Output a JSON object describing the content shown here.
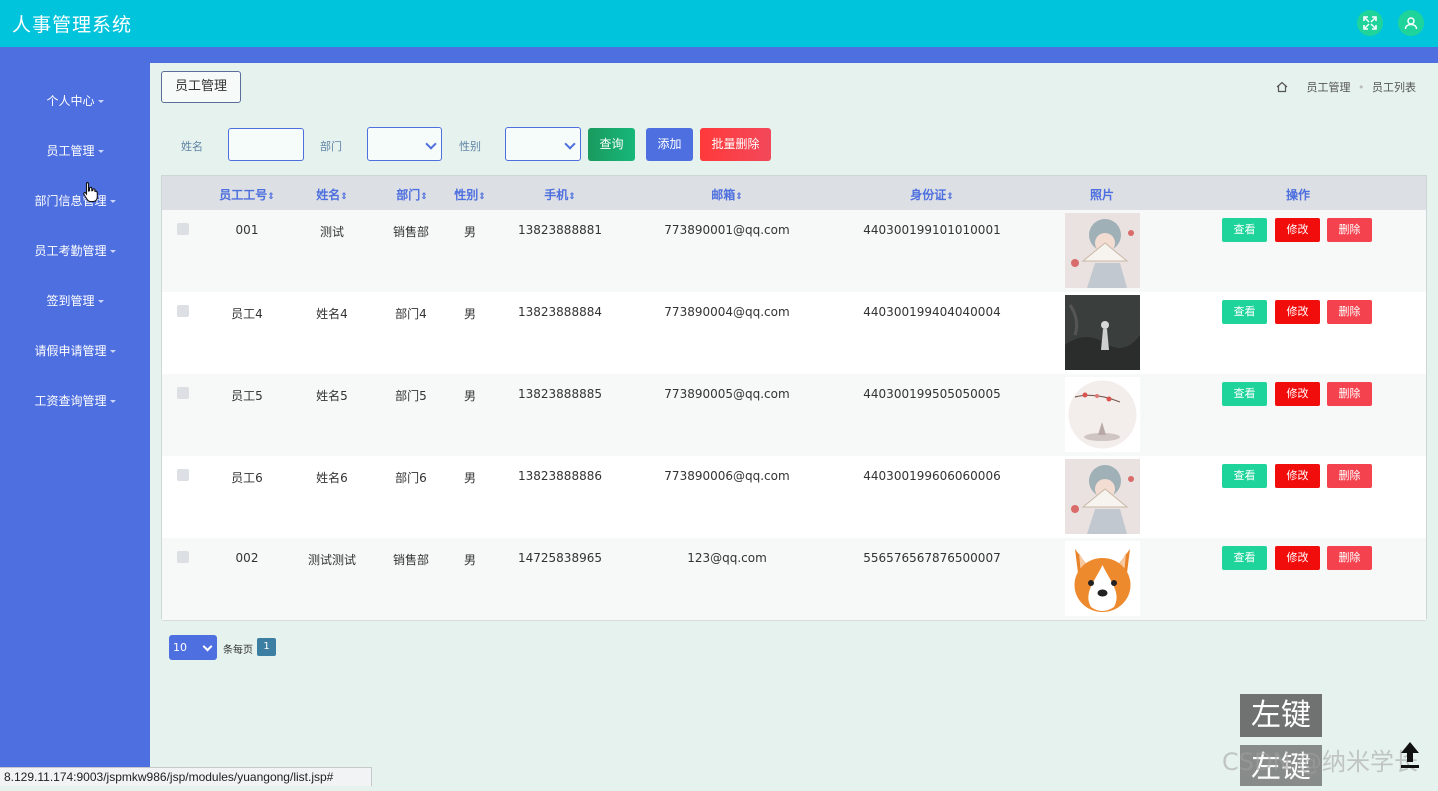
{
  "app": {
    "title": "人事管理系统",
    "colors": {
      "topbar": "#00c4dc",
      "sidebar": "#4e6fdf",
      "accent_green": "#1fd49a"
    }
  },
  "header_icons": [
    "fullscreen-icon",
    "user-icon"
  ],
  "sidebar": {
    "items": [
      {
        "label": "个人中心"
      },
      {
        "label": "员工管理"
      },
      {
        "label": "部门信息管理"
      },
      {
        "label": "员工考勤管理"
      },
      {
        "label": "签到管理"
      },
      {
        "label": "请假申请管理"
      },
      {
        "label": "工资查询管理"
      }
    ]
  },
  "main": {
    "tab_label": "员工管理",
    "breadcrumb": [
      "员工管理",
      "员工列表"
    ]
  },
  "filters": {
    "name_label": "姓名",
    "name_value": "",
    "dept_label": "部门",
    "dept_value": "",
    "gender_label": "性别",
    "gender_value": "",
    "query_button": "查询",
    "add_button": "添加",
    "batch_delete_button": "批量删除"
  },
  "table": {
    "headers": [
      {
        "label": "员工工号",
        "sortable": true
      },
      {
        "label": "姓名",
        "sortable": true
      },
      {
        "label": "部门",
        "sortable": true
      },
      {
        "label": "性别",
        "sortable": true
      },
      {
        "label": "手机",
        "sortable": true
      },
      {
        "label": "邮箱",
        "sortable": true
      },
      {
        "label": "身份证",
        "sortable": true
      },
      {
        "label": "照片",
        "sortable": false
      },
      {
        "label": "操作",
        "sortable": false
      }
    ],
    "sort_glyph": "⇕",
    "rows": [
      {
        "id": "001",
        "name": "测试",
        "dept": "销售部",
        "gender": "男",
        "phone": "13823888881",
        "email": "773890001@qq.com",
        "idcard": "440300199101010001",
        "photo": "girl-fan-portrait"
      },
      {
        "id": "员工4",
        "name": "姓名4",
        "dept": "部门4",
        "gender": "男",
        "phone": "13823888884",
        "email": "773890004@qq.com",
        "idcard": "440300199404040004",
        "photo": "dark-ink-painting"
      },
      {
        "id": "员工5",
        "name": "姓名5",
        "dept": "部门5",
        "gender": "男",
        "phone": "13823888885",
        "email": "773890005@qq.com",
        "idcard": "440300199505050005",
        "photo": "plum-blossom-circle"
      },
      {
        "id": "员工6",
        "name": "姓名6",
        "dept": "部门6",
        "gender": "男",
        "phone": "13823888886",
        "email": "773890006@qq.com",
        "idcard": "440300199606060006",
        "photo": "girl-fan-portrait"
      },
      {
        "id": "002",
        "name": "测试测试",
        "dept": "销售部",
        "gender": "男",
        "phone": "14725838965",
        "email": "123@qq.com",
        "idcard": "556576567876500007",
        "photo": "corgi-emoji"
      }
    ],
    "actions": {
      "view": "查看",
      "edit": "修改",
      "delete": "删除"
    },
    "action_colors": {
      "view": "#1fd49a",
      "edit": "#f20d0d",
      "delete": "#f4434f"
    }
  },
  "pager": {
    "page_size": "10",
    "per_page_label": "条每页",
    "current_page": "1"
  },
  "statusbar": {
    "url": "8.129.11.174:9003/jspmkw986/jsp/modules/yuangong/list.jsp#"
  },
  "overlays": {
    "key_badge_1": "左键",
    "key_badge_2": "左键",
    "watermark": "CSDN @纳米学长"
  }
}
